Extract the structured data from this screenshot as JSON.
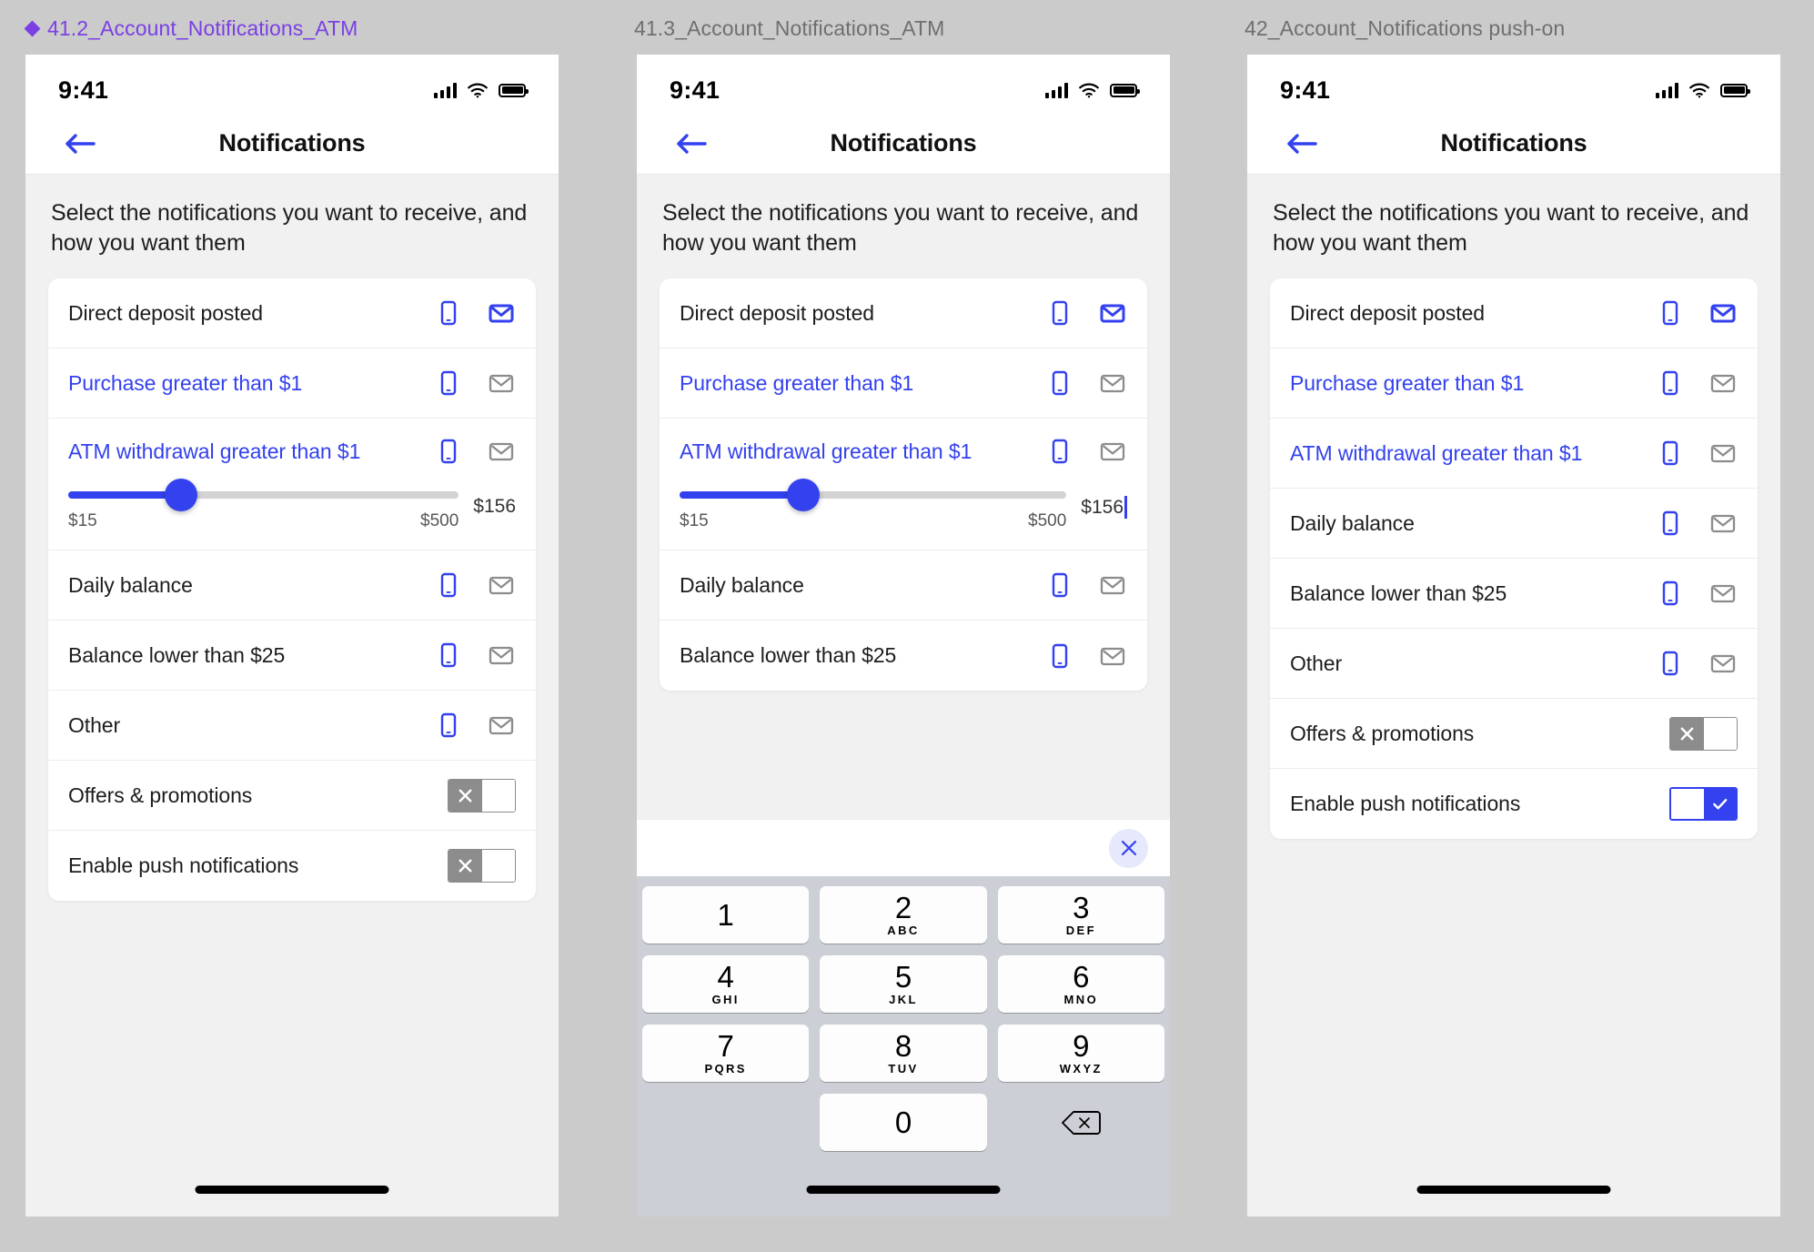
{
  "canvas": {
    "bg": "#cbcbcb"
  },
  "accent": {
    "blue": "#3341ee",
    "gray": "#8c8c8c",
    "purple": "#7B3FE4"
  },
  "frames": [
    {
      "id": "f1",
      "title": "41.2_Account_Notifications_ATM",
      "is_component": true,
      "statusbar": {
        "time": "9:41"
      },
      "navbar": {
        "title": "Notifications",
        "back_icon": "arrow-left-icon"
      },
      "subtitle": "Select the notifications you want to receive, and how you want them",
      "rows": [
        {
          "label": "Direct deposit posted",
          "label_blue": false,
          "phone": "on",
          "mail": "on",
          "type": "icons"
        },
        {
          "label": "Purchase greater than $1",
          "label_blue": true,
          "phone": "on",
          "mail": "off",
          "type": "icons"
        },
        {
          "label": "ATM withdrawal greater than $1",
          "label_blue": true,
          "phone": "on",
          "mail": "off",
          "type": "slider",
          "slider": {
            "value_label": "$156",
            "min_label": "$15",
            "max_label": "$500",
            "percent": 29,
            "caret": false
          }
        },
        {
          "label": "Daily balance",
          "label_blue": false,
          "phone": "on",
          "mail": "off",
          "type": "icons"
        },
        {
          "label": "Balance lower than $25",
          "label_blue": false,
          "phone": "on",
          "mail": "off",
          "type": "icons"
        },
        {
          "label": "Other",
          "label_blue": false,
          "phone": "on",
          "mail": "off",
          "type": "icons"
        },
        {
          "label": "Offers & promotions",
          "type": "toggle",
          "toggle_state": "off"
        },
        {
          "label": "Enable push notifications",
          "type": "toggle",
          "toggle_state": "off"
        }
      ],
      "keyboard": null
    },
    {
      "id": "f2",
      "title": "41.3_Account_Notifications_ATM",
      "is_component": false,
      "statusbar": {
        "time": "9:41"
      },
      "navbar": {
        "title": "Notifications",
        "back_icon": "arrow-left-icon"
      },
      "subtitle": "Select the notifications you want to receive, and how you want them",
      "rows": [
        {
          "label": "Direct deposit posted",
          "label_blue": false,
          "phone": "on",
          "mail": "on",
          "type": "icons"
        },
        {
          "label": "Purchase greater than $1",
          "label_blue": true,
          "phone": "on",
          "mail": "off",
          "type": "icons"
        },
        {
          "label": "ATM withdrawal greater than $1",
          "label_blue": true,
          "phone": "on",
          "mail": "off",
          "type": "slider",
          "slider": {
            "value_label": "$156",
            "min_label": "$15",
            "max_label": "$500",
            "percent": 32,
            "caret": true
          }
        },
        {
          "label": "Daily balance",
          "label_blue": false,
          "phone": "on",
          "mail": "off",
          "type": "icons"
        },
        {
          "label": "Balance lower than $25",
          "label_blue": false,
          "phone": "on",
          "mail": "off",
          "type": "icons"
        }
      ],
      "keyboard": {
        "close_icon": "close-icon",
        "keys": [
          {
            "num": "1",
            "sub": ""
          },
          {
            "num": "2",
            "sub": "ABC"
          },
          {
            "num": "3",
            "sub": "DEF"
          },
          {
            "num": "4",
            "sub": "GHI"
          },
          {
            "num": "5",
            "sub": "JKL"
          },
          {
            "num": "6",
            "sub": "MNO"
          },
          {
            "num": "7",
            "sub": "PQRS"
          },
          {
            "num": "8",
            "sub": "TUV"
          },
          {
            "num": "9",
            "sub": "WXYZ"
          },
          {
            "num": "0",
            "sub": ""
          }
        ],
        "backspace_icon": "backspace-icon"
      }
    },
    {
      "id": "f3",
      "title": "42_Account_Notifications push-on",
      "is_component": false,
      "statusbar": {
        "time": "9:41"
      },
      "navbar": {
        "title": "Notifications",
        "back_icon": "arrow-left-icon"
      },
      "subtitle": "Select the notifications you want to receive, and how you want them",
      "rows": [
        {
          "label": "Direct deposit posted",
          "label_blue": false,
          "phone": "on",
          "mail": "on",
          "type": "icons"
        },
        {
          "label": "Purchase greater than $1",
          "label_blue": true,
          "phone": "on",
          "mail": "off",
          "type": "icons"
        },
        {
          "label": "ATM withdrawal greater than $1",
          "label_blue": true,
          "phone": "on",
          "mail": "off",
          "type": "icons"
        },
        {
          "label": "Daily balance",
          "label_blue": false,
          "phone": "on",
          "mail": "off",
          "type": "icons"
        },
        {
          "label": "Balance lower than $25",
          "label_blue": false,
          "phone": "on",
          "mail": "off",
          "type": "icons"
        },
        {
          "label": "Other",
          "label_blue": false,
          "phone": "on",
          "mail": "off",
          "type": "icons"
        },
        {
          "label": "Offers & promotions",
          "type": "toggle",
          "toggle_state": "off"
        },
        {
          "label": "Enable push notifications",
          "type": "toggle",
          "toggle_state": "on"
        }
      ],
      "keyboard": null
    }
  ]
}
